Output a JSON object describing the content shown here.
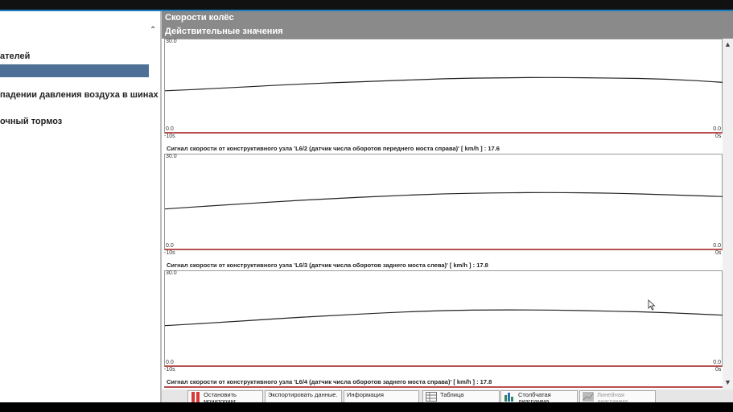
{
  "left_panel": {
    "items": [
      {
        "label": "ателей",
        "selected": false
      },
      {
        "label": "",
        "selected": true
      },
      {
        "label": "падении давления воздуха в шинах",
        "selected": false
      },
      {
        "label": "очный тормоз",
        "selected": false
      }
    ]
  },
  "header": {
    "title": "Скорости колёс",
    "subtitle": "Действительные значения"
  },
  "charts": [
    {
      "y_max_label": "30.0",
      "y_min_label_left": "0.0",
      "y_min_label_right": "0.0",
      "x_start_label": "-10s",
      "x_end_label": "0s",
      "signal_label": "Сигнал скорости от конструктивного узла 'L6/2 (датчик числа оборотов переднего моста справа)' [ km/h ] : 17.6"
    },
    {
      "y_max_label": "30.0",
      "y_min_label_left": "0.0",
      "y_min_label_right": "0.0",
      "x_start_label": "-10s",
      "x_end_label": "0s",
      "signal_label": "Сигнал скорости от конструктивного узла 'L6/3 (датчик числа оборотов заднего моста слева)' [ km/h ] : 17.8"
    },
    {
      "y_max_label": "30.0",
      "y_min_label_left": "0.0",
      "y_min_label_right": "0.0",
      "x_start_label": "-10s",
      "x_end_label": "0s",
      "signal_label": "Сигнал скорости от конструктивного узла 'L6/4 (датчик числа оборотов заднего моста справа)' [ km/h ] : 17.8"
    }
  ],
  "chart_data": [
    {
      "type": "line",
      "title": "",
      "xlabel": "",
      "ylabel": "",
      "xlim": [
        -10,
        0
      ],
      "ylim": [
        0,
        30
      ],
      "x": [
        -10,
        -9,
        -8,
        -7,
        -6,
        -5,
        -4,
        -3,
        -2,
        -1,
        0
      ],
      "series": [
        {
          "values": [
            13.5,
            14.3,
            15.3,
            16.1,
            16.7,
            17.4,
            17.7,
            17.8,
            17.6,
            17.3,
            16.2
          ]
        }
      ]
    },
    {
      "type": "line",
      "title": "",
      "xlabel": "",
      "ylabel": "",
      "xlim": [
        -10,
        0
      ],
      "ylim": [
        0,
        30
      ],
      "x": [
        -10,
        -9,
        -8,
        -7,
        -6,
        -5,
        -4,
        -3,
        -2,
        -1,
        0
      ],
      "series": [
        {
          "values": [
            12.8,
            14.0,
            15.1,
            16.1,
            16.9,
            17.6,
            17.9,
            18.0,
            17.8,
            17.3,
            16.7
          ]
        }
      ]
    },
    {
      "type": "line",
      "title": "",
      "xlabel": "",
      "ylabel": "",
      "xlim": [
        -10,
        0
      ],
      "ylim": [
        0,
        30
      ],
      "x": [
        -10,
        -9,
        -8,
        -7,
        -6,
        -5,
        -4,
        -3,
        -2,
        -1,
        0
      ],
      "series": [
        {
          "values": [
            12.8,
            13.8,
            15.0,
            16.0,
            16.9,
            17.6,
            17.8,
            17.7,
            17.4,
            16.9,
            16.1
          ]
        }
      ]
    }
  ],
  "scrollbar": {
    "up_icon": "▲",
    "down_icon": "▼"
  },
  "toolbar": {
    "stop_label": "Остановить мониторинг",
    "export_label": "Экспортировать данные.",
    "info_label": "Информация",
    "table_label": "Таблица",
    "bar_chart_label": "Столбчатая диаграмма",
    "line_chart_label": "Линейная диаграмма"
  },
  "colors": {
    "header_bg": "#8a8a8a",
    "selection": "#4e6f96",
    "chart_bottom_line": "#b95050",
    "accent_top": "#1a7fc0"
  }
}
